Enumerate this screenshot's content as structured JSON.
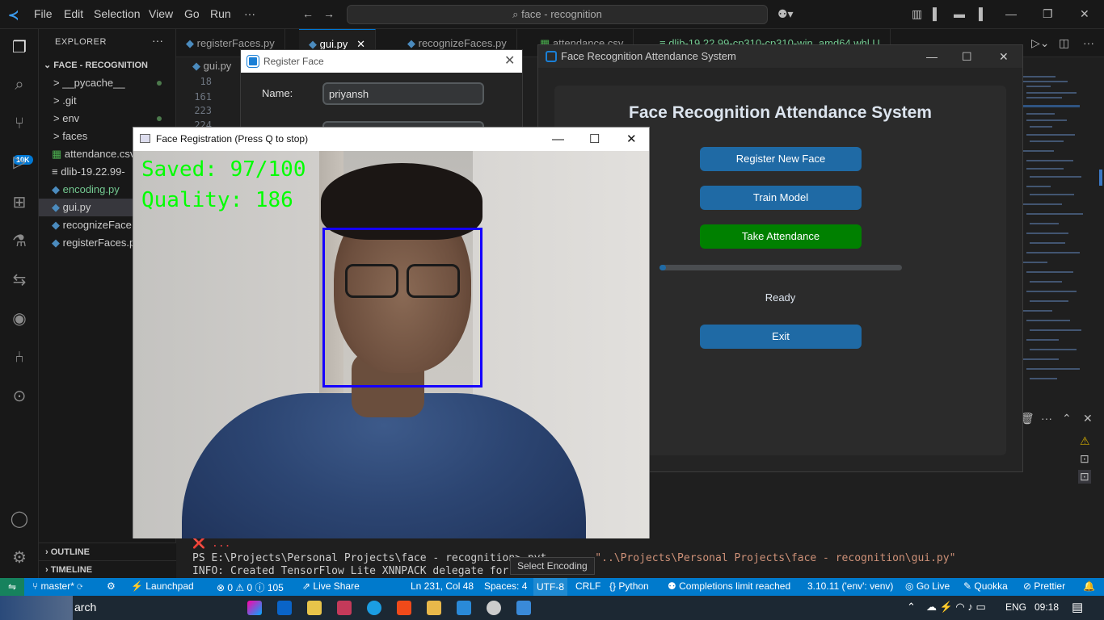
{
  "titlebar": {
    "menus": [
      "File",
      "Edit",
      "Selection",
      "View",
      "Go",
      "Run",
      "···"
    ],
    "search": "face - recognition"
  },
  "activity": {
    "badge": "10K"
  },
  "sidebar": {
    "explorer_title": "EXPLORER",
    "more": "···",
    "folder": "FACE - RECOGNITION",
    "items": [
      {
        "label": "__pycache__",
        "icon": ">"
      },
      {
        "label": ".git",
        "icon": ">"
      },
      {
        "label": "env",
        "icon": ">"
      },
      {
        "label": "faces",
        "icon": ">"
      },
      {
        "label": "attendance.csv",
        "icon": "▦"
      },
      {
        "label": "dlib-19.22.99-",
        "icon": "≡"
      },
      {
        "label": "encoding.py",
        "icon": "◆"
      },
      {
        "label": "gui.py",
        "icon": "◆"
      },
      {
        "label": "recognizeFace",
        "icon": "◆"
      },
      {
        "label": "registerFaces.p",
        "icon": "◆"
      }
    ],
    "outline": "OUTLINE",
    "timeline": "TIMELINE"
  },
  "tabs": [
    {
      "label": "registerFaces.py"
    },
    {
      "label": "gui.py",
      "close": "✕"
    },
    {
      "label": "recognizeFaces.py"
    },
    {
      "label": "attendance.csv"
    },
    {
      "label": "dlib-19.22.99-cp310-cp310-win_amd64.whl U"
    }
  ],
  "editor": {
    "breadcrumb": "gui.py",
    "line_numbers": [
      "18",
      "161",
      "223",
      "224"
    ]
  },
  "terminal": {
    "line1": "❌ ...",
    "prompt": "PS E:\\Projects\\Personal Projects\\face - recognition> pyt",
    "command": "\"..\\Projects\\Personal Projects\\face - recognition\\gui.py\"",
    "info": "INFO: Created TensorFlow Lite XNNPACK delegate for CPU."
  },
  "tooltip": "Select Encoding",
  "statusbar": {
    "branch": "master*",
    "launchpad": "Launchpad",
    "problems": "⊗ 0 ⚠ 0 ⓘ 105",
    "liveshare": "Live Share",
    "position": "Ln 231, Col 48",
    "spaces": "Spaces: 4",
    "encoding": "UTF-8",
    "eol": "CRLF",
    "language": "Python",
    "completions": "Completions limit reached",
    "interpreter": "3.10.11 ('env': venv)",
    "golive": "Go Live",
    "quokka": "Quokka",
    "prettier": "Prettier"
  },
  "taskbar": {
    "search": "arch",
    "lang": "ENG",
    "time": "09:18"
  },
  "register_dialog": {
    "title": "Register Face",
    "name_label": "Name:",
    "name_value": "priyansh"
  },
  "attendance_window": {
    "title": "Face Recognition Attendance System",
    "heading": "Face Recognition Attendance System",
    "buttons": {
      "register": "Register New Face",
      "train": "Train Model",
      "take": "Take Attendance",
      "exit": "Exit"
    },
    "progress": 0.01,
    "status": "Ready"
  },
  "camera_window": {
    "title": "Face Registration (Press Q to stop)",
    "saved": "Saved: 97/100",
    "quality": "Quality: 186"
  },
  "colors": {
    "accent": "#007acc",
    "ctk_button": "#1f6aa5",
    "take_button": "#008000",
    "cv_text": "#00ff00",
    "face_box": "#1500ff"
  }
}
